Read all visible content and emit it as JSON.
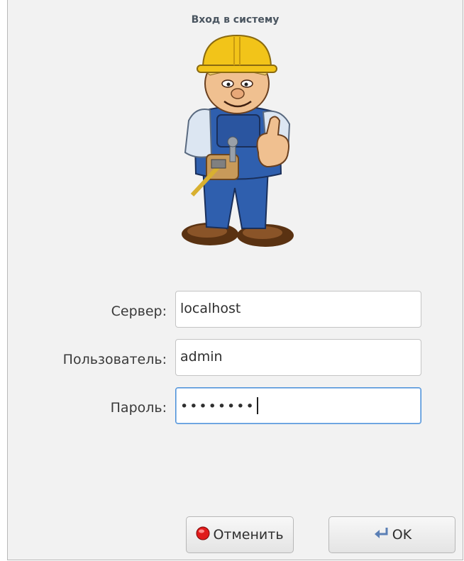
{
  "window": {
    "title": "Вход в систему"
  },
  "mascot": {
    "icon": "construction-worker-thumbs-up-icon"
  },
  "form": {
    "server_label": "Сервер:",
    "server_value": "localhost",
    "user_label": "Пользователь:",
    "user_value": "admin",
    "password_label": "Пароль:",
    "password_value": "••••••••"
  },
  "buttons": {
    "cancel_label": "Отменить",
    "cancel_icon": "stop-red-circle-icon",
    "ok_label": "OK",
    "ok_icon": "enter-return-arrow-icon"
  },
  "colors": {
    "focus_border": "#4a90d9",
    "cancel_icon": "#e01b1b",
    "helmet": "#f2c419",
    "overalls": "#2f5fae"
  }
}
